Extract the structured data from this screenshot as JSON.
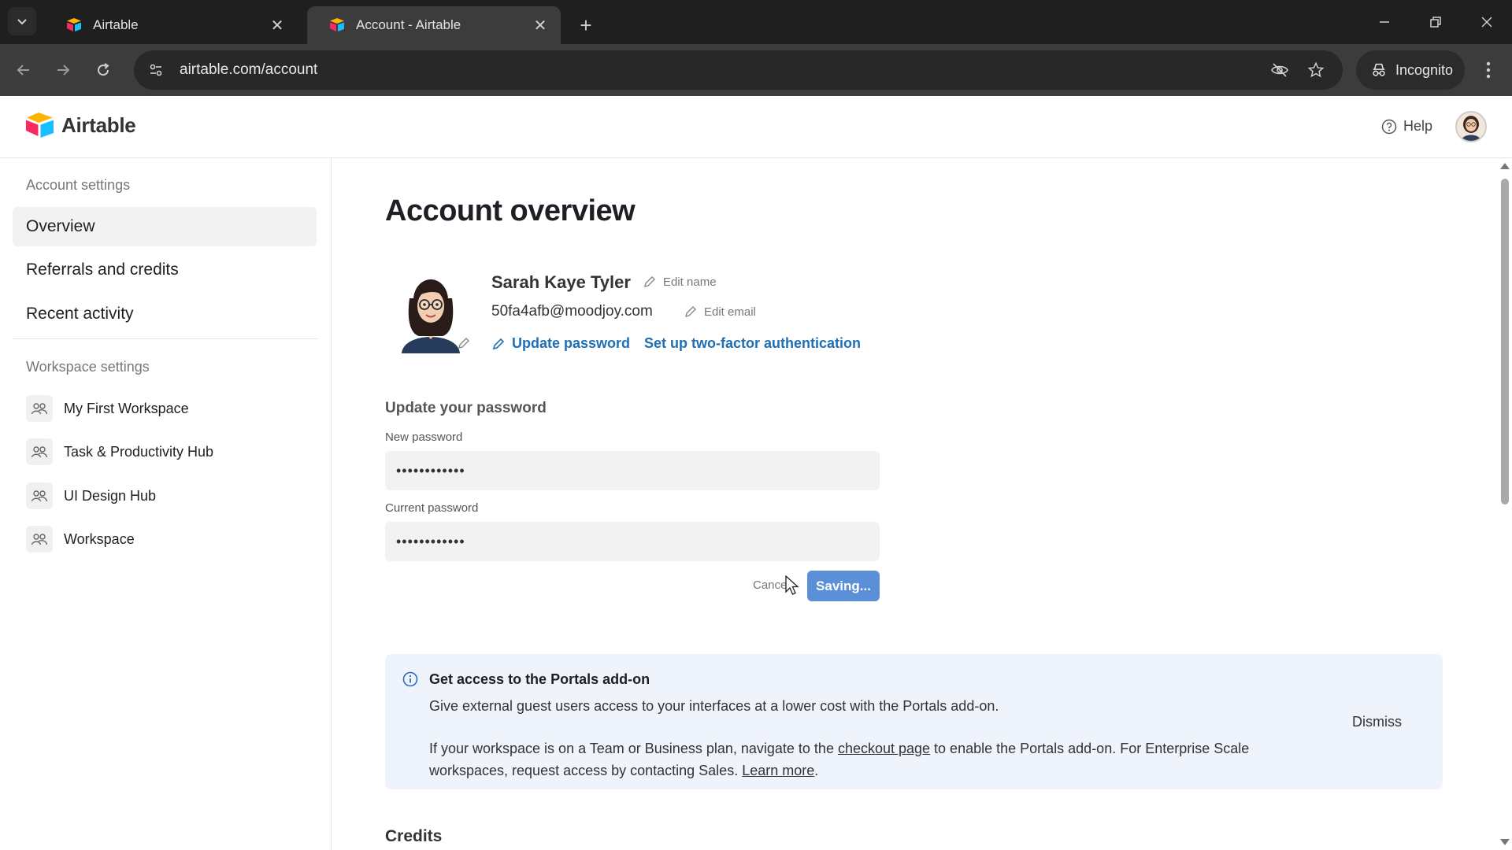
{
  "browser": {
    "tabs": [
      {
        "title": "Airtable",
        "active": false
      },
      {
        "title": "Account - Airtable",
        "active": true
      }
    ],
    "url": "airtable.com/account",
    "incognito_label": "Incognito"
  },
  "header": {
    "brand": "Airtable",
    "help_label": "Help"
  },
  "sidebar": {
    "account_heading": "Account settings",
    "account_items": [
      {
        "label": "Overview",
        "active": true
      },
      {
        "label": "Referrals and credits",
        "active": false
      },
      {
        "label": "Recent activity",
        "active": false
      }
    ],
    "workspace_heading": "Workspace settings",
    "workspaces": [
      {
        "label": "My First Workspace"
      },
      {
        "label": "Task & Productivity Hub"
      },
      {
        "label": "UI Design Hub"
      },
      {
        "label": "Workspace"
      }
    ]
  },
  "main": {
    "title": "Account overview",
    "profile": {
      "name": "Sarah Kaye Tyler",
      "email": "50fa4afb@moodjoy.com",
      "edit_name_label": "Edit name",
      "edit_email_label": "Edit email",
      "update_password_label": "Update password",
      "two_factor_label": "Set up two-factor authentication"
    },
    "password_form": {
      "heading": "Update your password",
      "new_password_label": "New password",
      "new_password_value": "••••••••••••",
      "current_password_label": "Current password",
      "current_password_value": "••••••••••••",
      "cancel_label": "Cancel",
      "saving_label": "Saving..."
    },
    "banner": {
      "title": "Get access to the Portals add-on",
      "text1": "Give external guest users access to your interfaces at a lower cost with the Portals add-on.",
      "text2_part1": "If your workspace is on a Team or Business plan, navigate to the ",
      "checkout_link": "checkout page",
      "text2_part2": " to enable the Portals add-on. For Enterprise Scale workspaces, request access by contacting Sales. ",
      "learn_more_link": "Learn more",
      "text2_part3": ".",
      "dismiss_label": "Dismiss"
    },
    "credits_title": "Credits"
  },
  "colors": {
    "accent_blue": "#1f6fb5",
    "saving_button": "#5b8fd8",
    "banner_bg": "#eef3fc",
    "chrome_dark": "#1f1f1f"
  }
}
